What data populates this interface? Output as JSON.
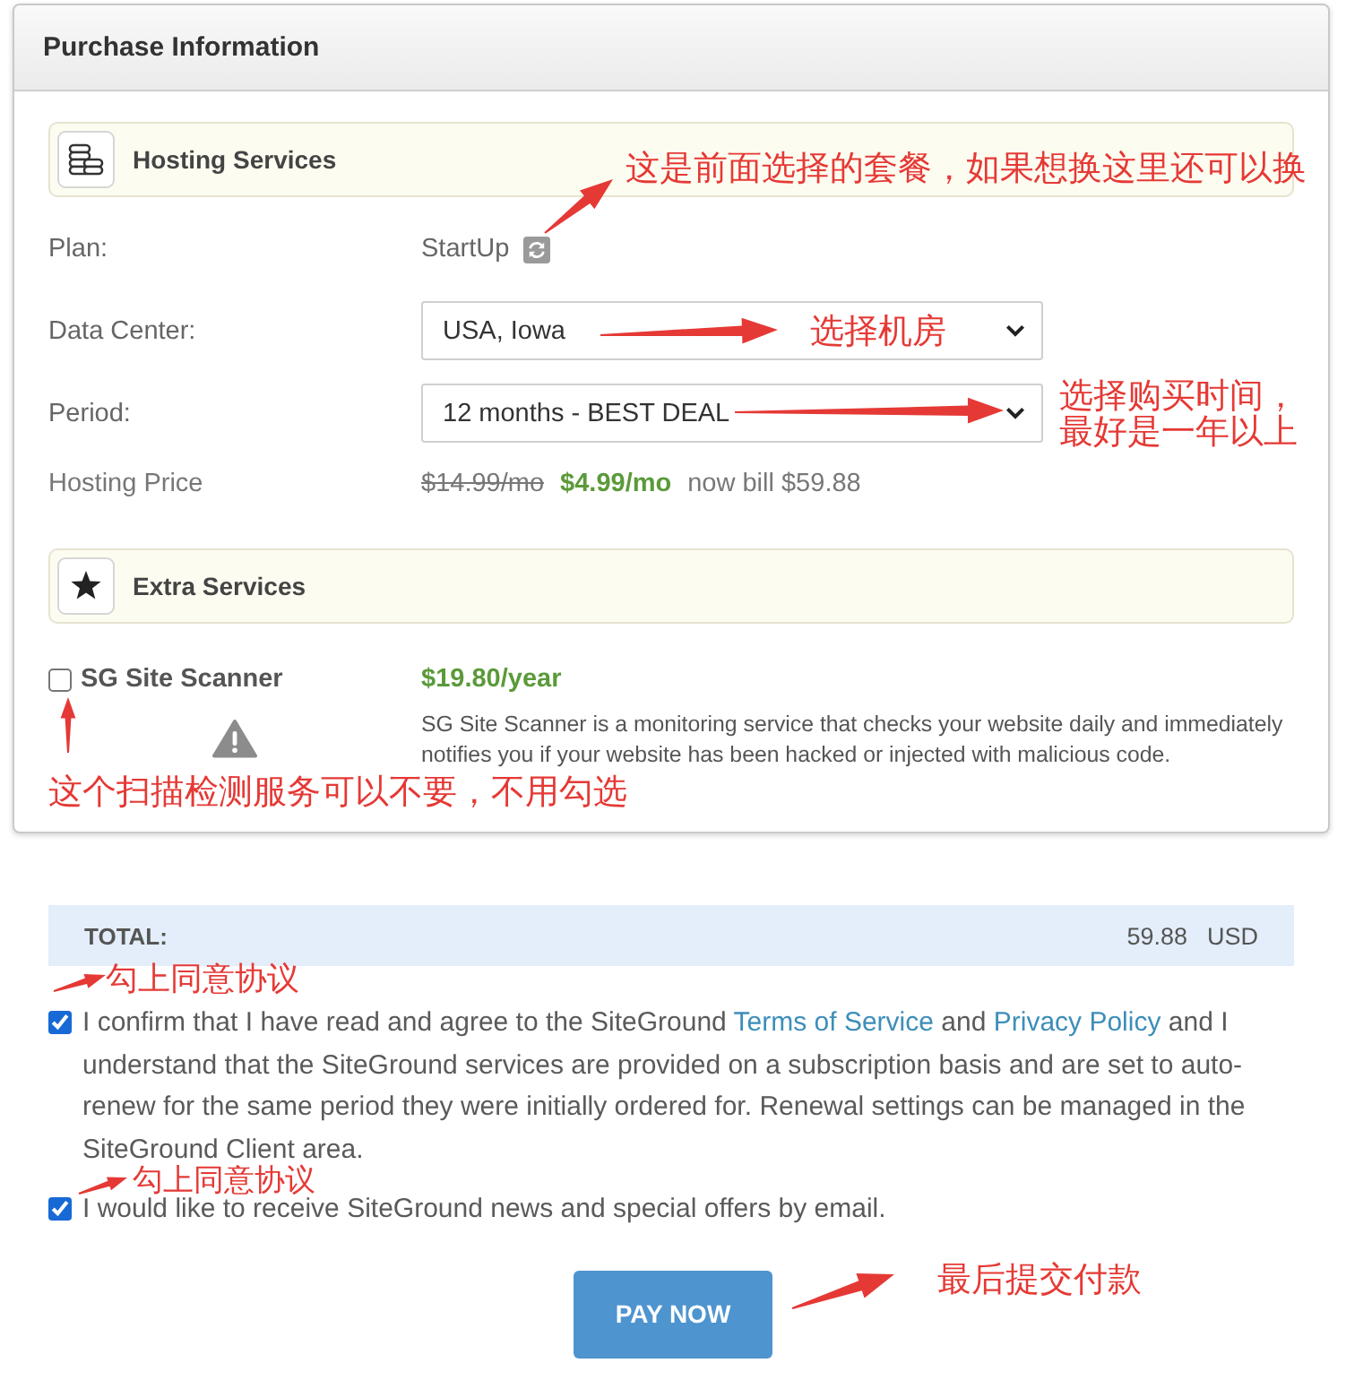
{
  "purchase_panel": {
    "title": "Purchase Information",
    "hosting": {
      "heading": "Hosting Services",
      "rows": [
        {
          "kind": "plan",
          "label": "Plan:",
          "value": "StartUp"
        },
        {
          "kind": "select",
          "label": "Data Center:",
          "value": "USA, Iowa"
        },
        {
          "kind": "select",
          "label": "Period:",
          "value": "12 months - BEST DEAL"
        },
        {
          "kind": "price",
          "label": "Hosting Price",
          "old_price": "$14.99/mo",
          "new_price": "$4.99/mo",
          "note": "now bill $59.88"
        }
      ]
    },
    "extras": {
      "heading": "Extra Services",
      "items": [
        {
          "name": "SG Site Scanner",
          "checked": false,
          "price": "$19.80/year",
          "description": "SG Site Scanner is a monitoring service that checks your website daily and immediately notifies you if your website has been hacked or injected with malicious code."
        }
      ]
    }
  },
  "total": {
    "label": "TOTAL:",
    "amount": "59.88",
    "currency": "USD"
  },
  "agreements": [
    {
      "checked": true,
      "parts": [
        {
          "kind": "text",
          "text": "I confirm that I have read and agree to the SiteGround "
        },
        {
          "kind": "link",
          "text": "Terms of Service"
        },
        {
          "kind": "text",
          "text": " and "
        },
        {
          "kind": "link",
          "text": "Privacy Policy"
        },
        {
          "kind": "text",
          "text": " and I understand that the SiteGround services are provided on a subscription basis and are set to auto-renew for the same period they were initially ordered for. Renewal settings can be managed in the SiteGround Client area."
        }
      ]
    },
    {
      "checked": true,
      "parts": [
        {
          "kind": "text",
          "text": "I would like to receive SiteGround news and special offers by email."
        }
      ]
    }
  ],
  "pay_button": {
    "label": "PAY NOW"
  },
  "annotations": [
    {
      "text": "这是前面选择的套餐，如果想换这里还可以换"
    },
    {
      "text": "选择机房"
    },
    {
      "text": "选择购买时间，最好是一年以上"
    },
    {
      "text": "这个扫描检测服务可以不要，不用勾选"
    },
    {
      "text": "勾上同意协议"
    },
    {
      "text": "勾上同意协议"
    },
    {
      "text": "最后提交付款"
    }
  ]
}
